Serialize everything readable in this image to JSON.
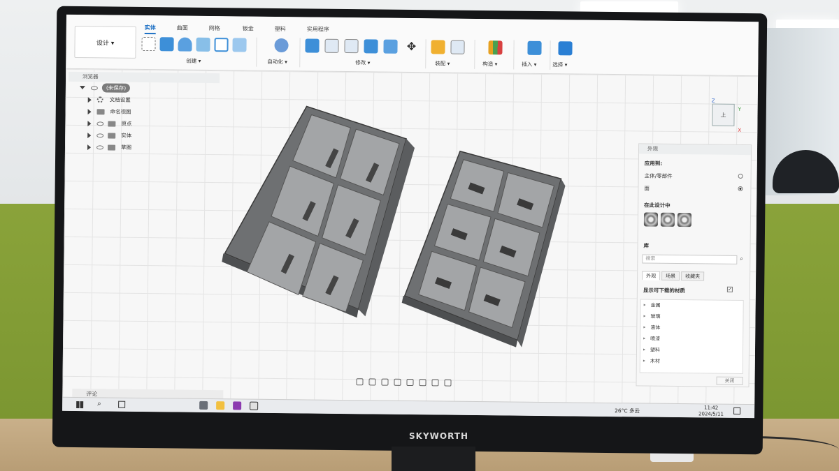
{
  "toolbar": {
    "design_button": "设计 ▾",
    "tabs": [
      "实体",
      "曲面",
      "网格",
      "钣金",
      "塑料",
      "实用程序"
    ],
    "groups": [
      "创建 ▾",
      "自动化 ▾",
      "修改 ▾",
      "装配 ▾",
      "构造 ▾",
      "插入 ▾",
      "选择 ▾"
    ]
  },
  "browser": {
    "header": "浏览器",
    "root": "(未保存)",
    "items": [
      "文档设置",
      "命名视图",
      "原点",
      "实体",
      "草图"
    ]
  },
  "viewcube": {
    "face": "上",
    "axes": [
      "Z",
      "Y",
      "X"
    ]
  },
  "appearance": {
    "title": "外观",
    "apply_to": "应用到:",
    "opt_body": "主体/零部件",
    "opt_face": "面",
    "in_design": "在此设计中",
    "library": "库",
    "search_placeholder": "搜索",
    "tabs": [
      "外观",
      "场景",
      "收藏夹"
    ],
    "show_downloadable": "显示可下载的材质",
    "categories": [
      "金属",
      "玻璃",
      "液体",
      "喷漆",
      "塑料",
      "木材"
    ],
    "close": "关闭"
  },
  "comments": {
    "label": "评论"
  },
  "taskbar": {
    "weather": "26°C 多云",
    "time": "11:42",
    "date": "2024/5/11"
  },
  "monitor": {
    "brand": "SKYWORTH"
  },
  "colors": {
    "accent": "#1b6fc4",
    "tray": "#7a7c7e",
    "tray_inner": "#9c9ea0",
    "wall": "#8aa33a"
  }
}
